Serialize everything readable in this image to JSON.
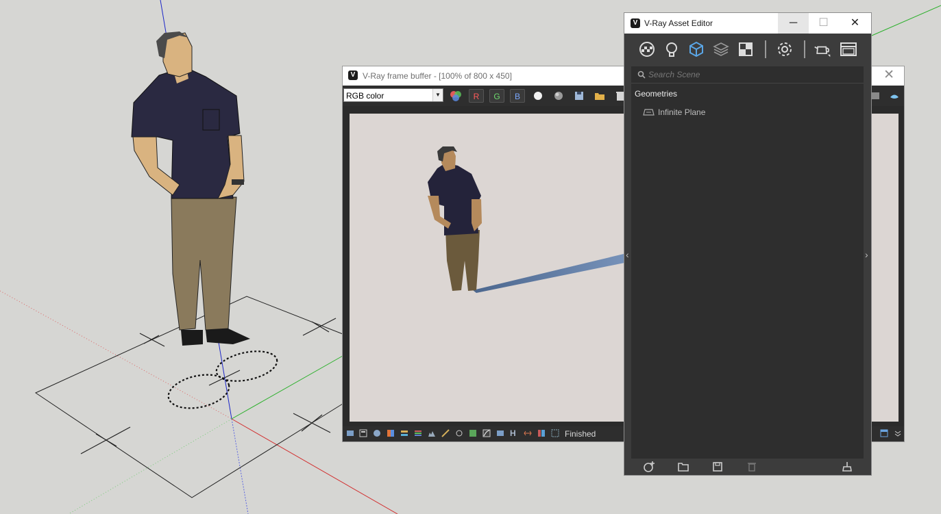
{
  "frame_buffer": {
    "title": "V-Ray frame buffer - [100% of 800 x 450]",
    "close_label": "✕",
    "channel_select": {
      "value": "RGB color",
      "arrow": "▼"
    },
    "channel_buttons": {
      "r": "R",
      "g": "G",
      "b": "B"
    },
    "status_icons": {
      "h_label": "H"
    },
    "status_text": "Finished"
  },
  "asset_editor": {
    "title": "V-Ray Asset Editor",
    "window_buttons": {
      "minimize": "─",
      "maximize": "☐",
      "close": "✕"
    },
    "toolbar_icons": [
      "materials-icon",
      "lights-icon",
      "geometry-icon",
      "textures-icon",
      "render-elements-icon",
      "settings-icon",
      "render-teapot-icon",
      "frame-buffer-icon"
    ],
    "search": {
      "placeholder": "Search Scene"
    },
    "category": "Geometries",
    "items": [
      {
        "label": "Infinite Plane",
        "icon": "infinite-plane-icon"
      }
    ],
    "left_arrow": "‹",
    "right_arrow": "›",
    "footer_icons": [
      "add-asset-icon",
      "open-file-icon",
      "save-icon",
      "delete-icon",
      "purge-icon"
    ]
  },
  "colors": {
    "viewport_bg": "#d6d6d3",
    "panel_dark": "#2e2e2e",
    "window_frame": "#3c3c3c",
    "channel_r": "#ff5a5a",
    "channel_g": "#6edc6e",
    "channel_b": "#7aa8ff",
    "accent_blue": "#5aa6e6"
  }
}
